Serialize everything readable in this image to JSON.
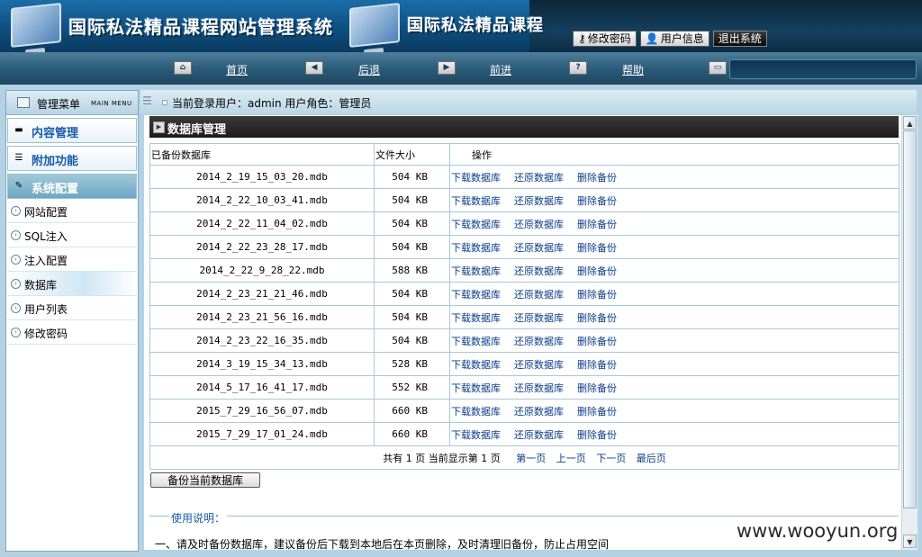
{
  "header": {
    "title": "国际私法精品课程网站管理系统",
    "title_dup": "国际私法精品课程",
    "buttons": [
      {
        "label": "修改密码",
        "icon": "key-icon"
      },
      {
        "label": "用户信息",
        "icon": "user-icon"
      },
      {
        "label": "退出系统",
        "icon": null
      }
    ]
  },
  "nav": {
    "items": [
      {
        "label": "首页",
        "icon": "home-icon"
      },
      {
        "label": "后退",
        "icon": "back-arrow-icon"
      },
      {
        "label": "前进",
        "icon": "forward-arrow-icon"
      },
      {
        "label": "帮助",
        "icon": "help-icon"
      }
    ]
  },
  "sidebar": {
    "title": "管理菜单",
    "subtitle": "MAIN MENU",
    "sections": [
      {
        "label": "内容管理",
        "icon": "content-icon",
        "active": false
      },
      {
        "label": "附加功能",
        "icon": "extra-icon",
        "active": false
      },
      {
        "label": "系统配置",
        "icon": "config-icon",
        "active": true
      }
    ],
    "items": [
      {
        "label": "网站配置"
      },
      {
        "label": "SQL注入"
      },
      {
        "label": "注入配置"
      },
      {
        "label": "数据库"
      },
      {
        "label": "用户列表"
      },
      {
        "label": "修改密码"
      }
    ]
  },
  "info_bar": {
    "text": "当前登录用户：admin  用户角色：管理员"
  },
  "panel": {
    "title": "数据库管理",
    "columns": [
      "已备份数据库",
      "文件大小",
      "操作"
    ],
    "actions": [
      "下载数据库",
      "还原数据库",
      "删除备份"
    ],
    "rows": [
      {
        "name": "2014_2_19_15_03_20.mdb",
        "size": "504 KB"
      },
      {
        "name": "2014_2_22_10_03_41.mdb",
        "size": "504 KB"
      },
      {
        "name": "2014_2_22_11_04_02.mdb",
        "size": "504 KB"
      },
      {
        "name": "2014_2_22_23_28_17.mdb",
        "size": "504 KB"
      },
      {
        "name": "2014_2_22_9_28_22.mdb",
        "size": "588 KB"
      },
      {
        "name": "2014_2_23_21_21_46.mdb",
        "size": "504 KB"
      },
      {
        "name": "2014_2_23_21_56_16.mdb",
        "size": "504 KB"
      },
      {
        "name": "2014_2_23_22_16_35.mdb",
        "size": "504 KB"
      },
      {
        "name": "2014_3_19_15_34_13.mdb",
        "size": "528 KB"
      },
      {
        "name": "2014_5_17_16_41_17.mdb",
        "size": "552 KB"
      },
      {
        "name": "2015_7_29_16_56_07.mdb",
        "size": "660 KB"
      },
      {
        "name": "2015_7_29_17_01_24.mdb",
        "size": "660 KB"
      }
    ],
    "pager": {
      "summary": "共有 1 页   当前显示第 1 页",
      "links": [
        "第一页",
        "上一页",
        "下一页",
        "最后页"
      ]
    },
    "backup_button": "备份当前数据库",
    "usage_title": "使用说明：",
    "usage_text": "一、请及时备份数据库，建议备份后下载到本地后在本页删除，及时清理旧备份，防止占用空间"
  },
  "watermark": "www.wooyun.org"
}
